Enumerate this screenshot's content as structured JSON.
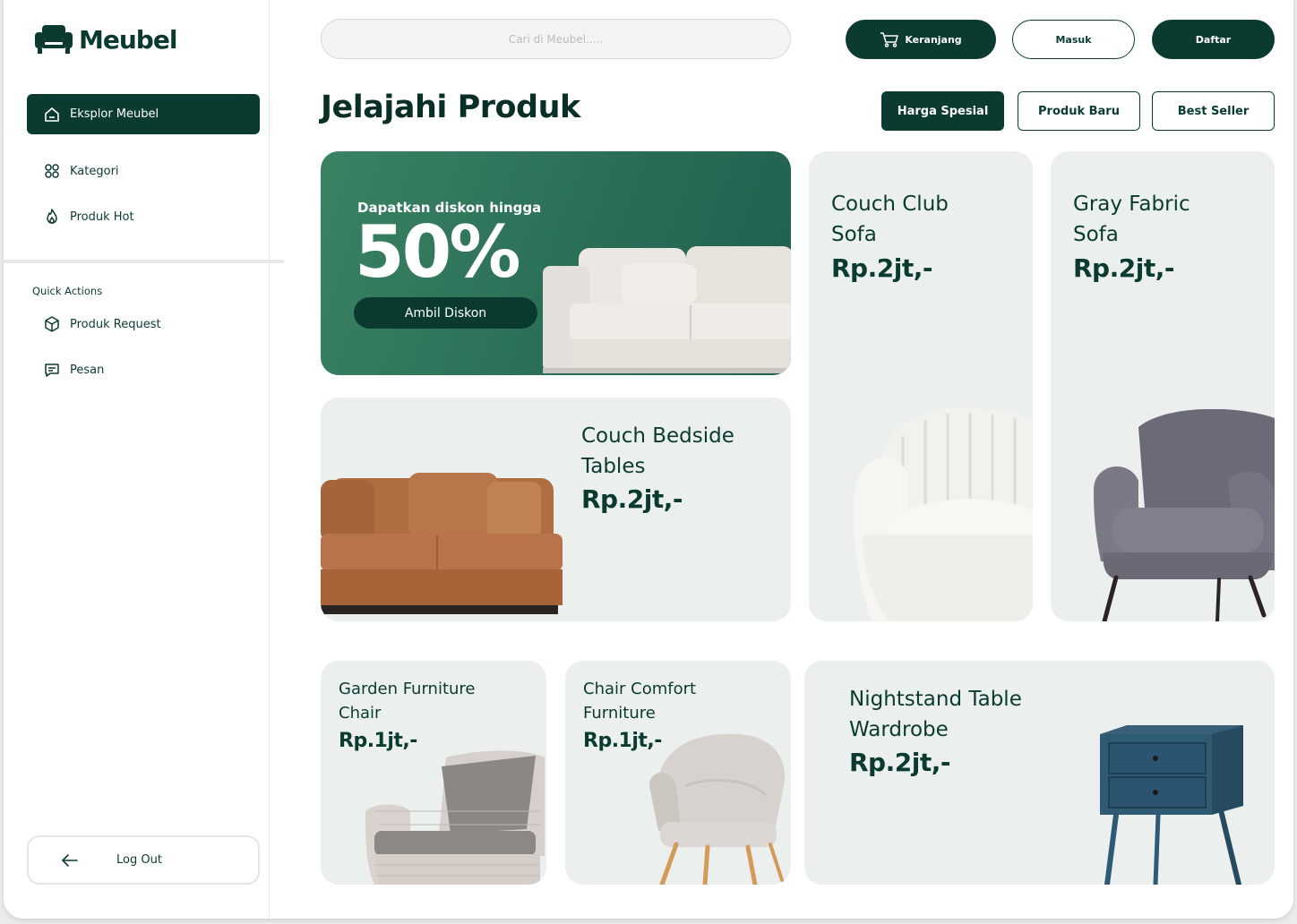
{
  "app": {
    "logo_text": "Meubel"
  },
  "sidebar": {
    "nav": [
      {
        "label": "Eksplor Meubel",
        "icon": "home-icon",
        "active": true
      },
      {
        "label": "Kategori",
        "icon": "grid-icon"
      },
      {
        "label": "Produk Hot",
        "icon": "flame-icon"
      }
    ],
    "quick_actions_title": "Quick Actions",
    "quick_actions": [
      {
        "label": "Produk Request",
        "icon": "box-icon"
      },
      {
        "label": "Pesan",
        "icon": "message-icon"
      }
    ],
    "logout_label": "Log Out"
  },
  "header": {
    "search_placeholder": "Cari di Meubel.....",
    "cart_label": "Keranjang",
    "login_label": "Masuk",
    "register_label": "Daftar"
  },
  "main": {
    "title": "Jelajahi Produk",
    "filters": [
      "Harga Spesial",
      "Produk Baru",
      "Best Seller"
    ],
    "promo": {
      "subtitle": "Dapatkan diskon hingga",
      "headline": "50%",
      "button": "Ambil Diskon"
    },
    "products": [
      {
        "name_line1": "Couch Club",
        "name_line2": "Sofa",
        "price": "Rp.2jt,-"
      },
      {
        "name_line1": "Gray Fabric",
        "name_line2": "Sofa",
        "price": "Rp.2jt,-"
      },
      {
        "name_line1": "Couch Bedside",
        "name_line2": "Tables",
        "price": "Rp.2jt,-"
      },
      {
        "name_line1": "Garden Furniture",
        "name_line2": "Chair",
        "price": "Rp.1jt,-"
      },
      {
        "name_line1": "Chair Comfort",
        "name_line2": "Furniture",
        "price": "Rp.1jt,-"
      },
      {
        "name_line1": "Nightstand Table",
        "name_line2": "Wardrobe",
        "price": "Rp.2jt,-"
      }
    ]
  },
  "colors": {
    "primary": "#0b3b30",
    "promo": "#2e7459",
    "card_bg": "#ebf0ee"
  }
}
